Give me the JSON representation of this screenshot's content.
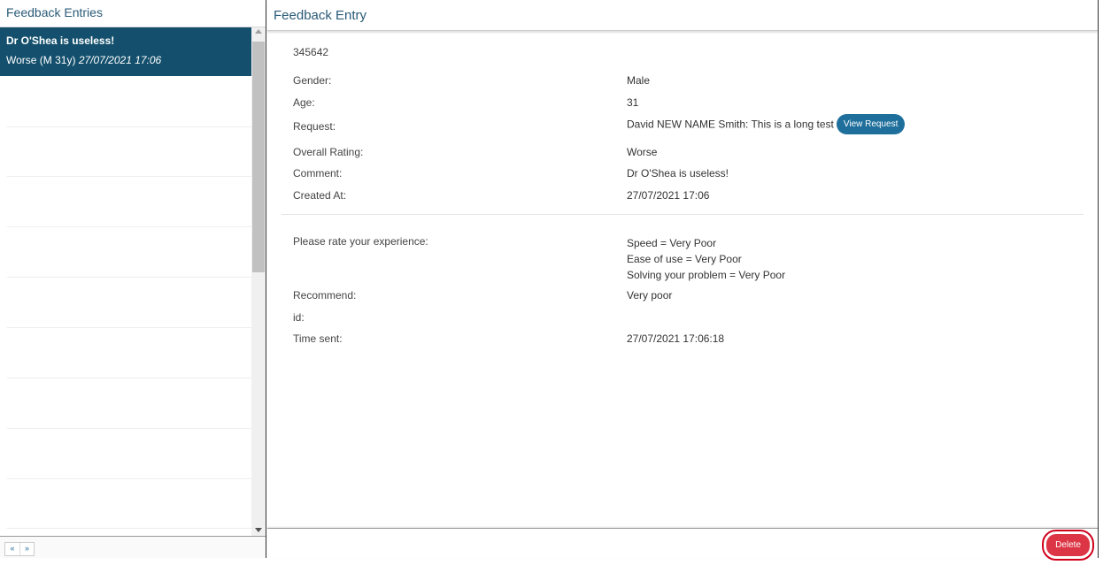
{
  "left": {
    "title": "Feedback Entries",
    "entries": [
      {
        "title": "Dr O'Shea is useless!",
        "summary": "Worse (M 31y)",
        "date": "27/07/2021 17:06"
      }
    ],
    "pager": {
      "prev": "«",
      "next": "»"
    }
  },
  "right": {
    "title": "Feedback Entry",
    "entry_id": "345642",
    "fields": {
      "gender_label": "Gender:",
      "gender_value": "Male",
      "age_label": "Age:",
      "age_value": "31",
      "request_label": "Request:",
      "request_value": "David NEW NAME Smith: This is a long test",
      "view_request_button": "View Request",
      "rating_label": "Overall Rating:",
      "rating_value": "Worse",
      "comment_label": "Comment:",
      "comment_value": "Dr O'Shea is useless!",
      "created_label": "Created At:",
      "created_value": "27/07/2021 17:06"
    },
    "survey": {
      "experience_label": "Please rate your experience:",
      "experience_values": [
        "Speed = Very Poor",
        "Ease of use = Very Poor",
        "Solving your problem = Very Poor"
      ],
      "recommend_label": "Recommend:",
      "recommend_value": "Very poor",
      "id_label": "id:",
      "time_label": "Time sent:",
      "time_value": "27/07/2021 17:06:18"
    },
    "delete_button": "Delete"
  },
  "colors": {
    "accent": "#14506d",
    "header_text": "#2a5a77",
    "button": "#1e6f9b",
    "danger": "#dc3545"
  }
}
